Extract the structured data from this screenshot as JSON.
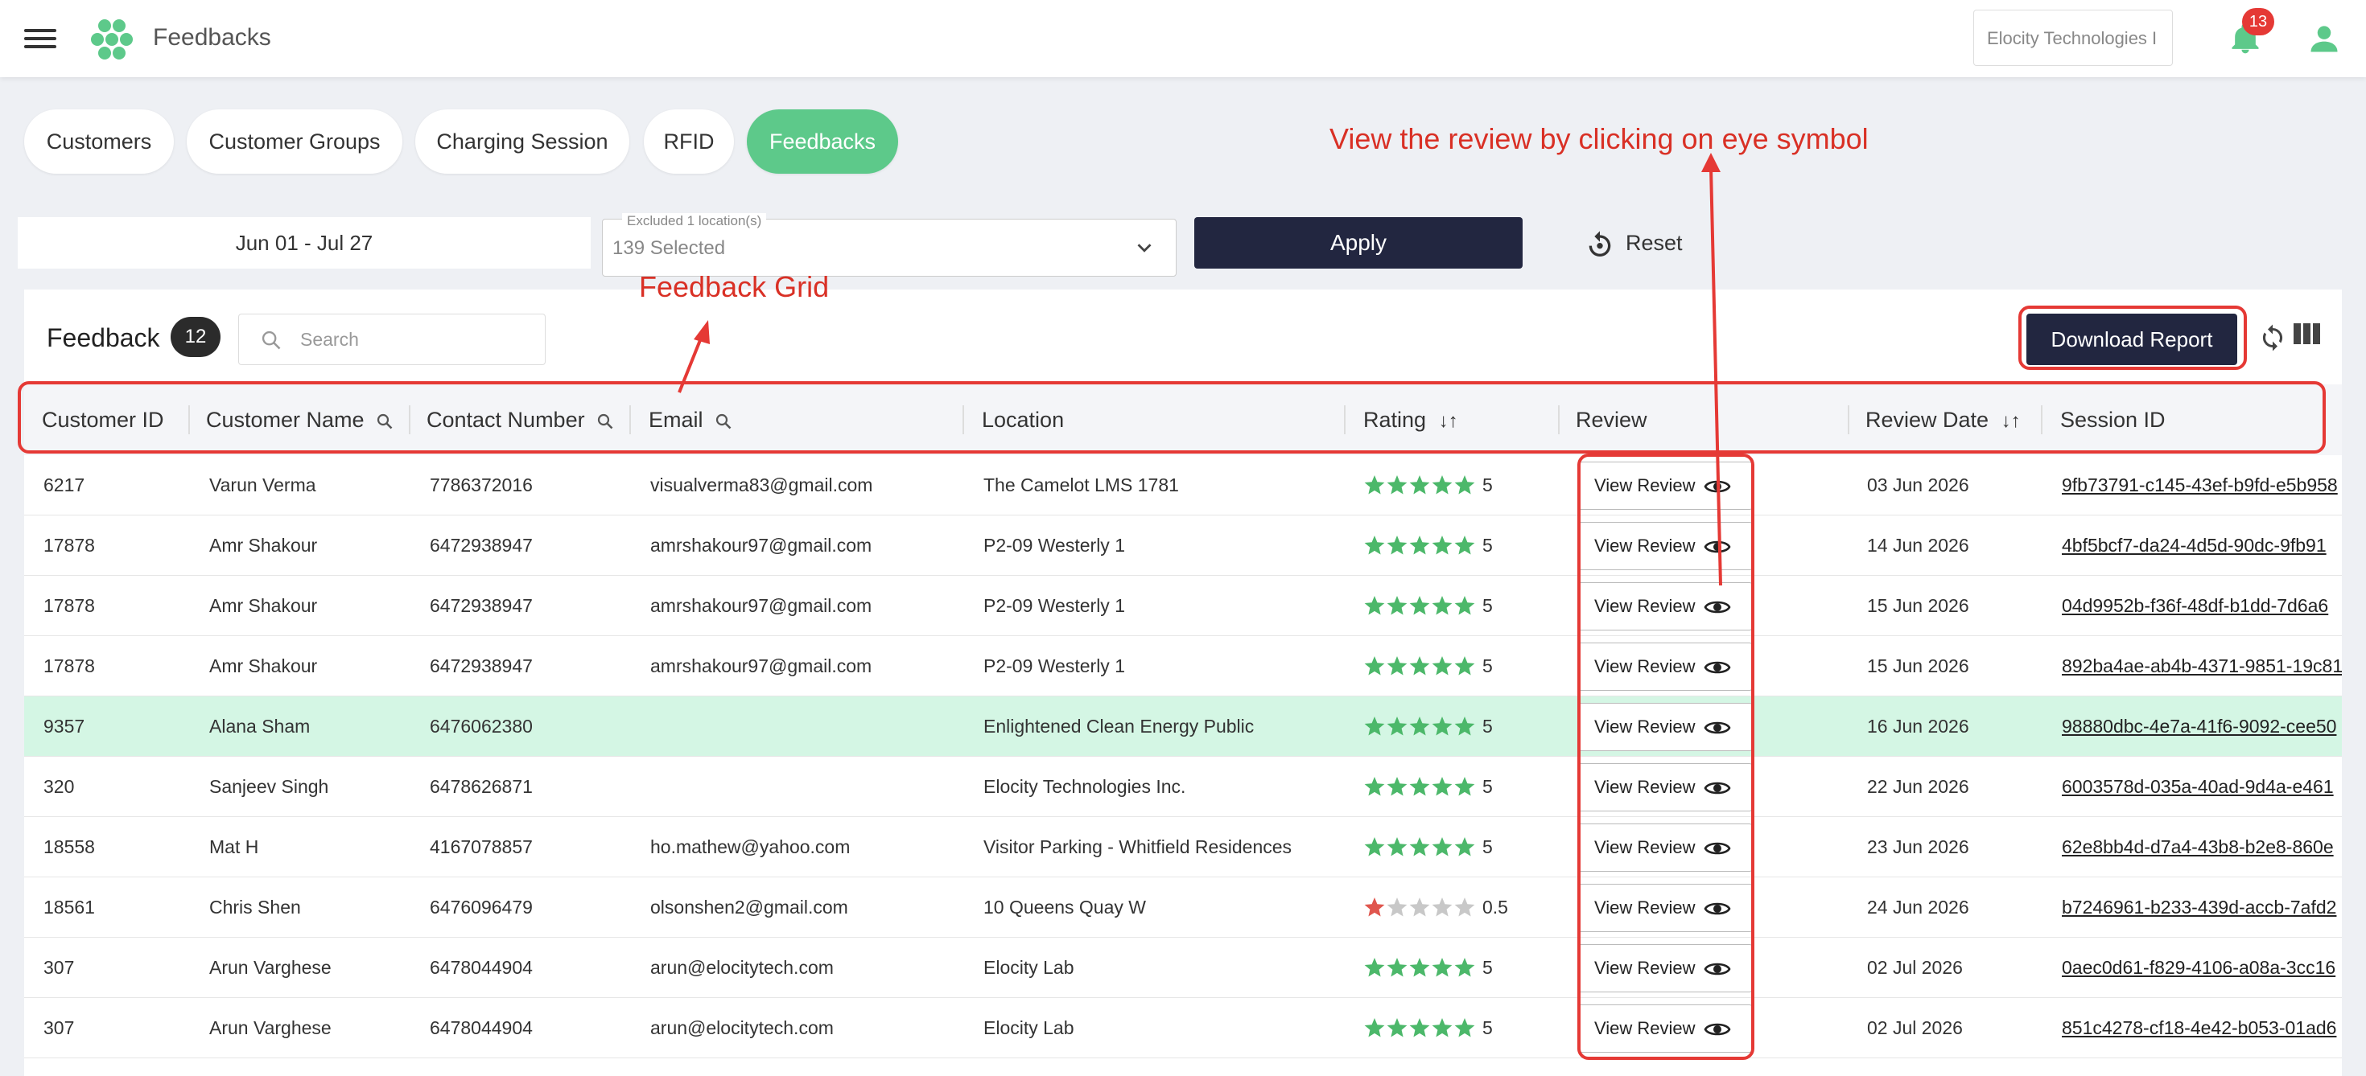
{
  "app": {
    "title": "Feedbacks"
  },
  "header": {
    "org_selector": "Elocity Technologies I",
    "notification_count": "13"
  },
  "tabs": [
    {
      "label": "Customers",
      "active": false
    },
    {
      "label": "Customer Groups",
      "active": false
    },
    {
      "label": "Charging Session",
      "active": false
    },
    {
      "label": "RFID",
      "active": false
    },
    {
      "label": "Feedbacks",
      "active": true
    }
  ],
  "filters": {
    "date_range": "Jun 01 - Jul 27",
    "location_label": "Excluded 1 location(s)",
    "location_value": "139 Selected",
    "apply_label": "Apply",
    "reset_label": "Reset"
  },
  "grid": {
    "title": "Feedback",
    "count": "12",
    "search_placeholder": "Search",
    "download_label": "Download Report",
    "columns": [
      "Customer ID",
      "Customer Name",
      "Contact Number",
      "Email",
      "Location",
      "Rating",
      "Review",
      "Review Date",
      "Session ID"
    ],
    "rows": [
      {
        "customer_id": "6217",
        "name": "Varun Verma",
        "contact": "7786372016",
        "email": "visualverma83@gmail.com",
        "location": "The Camelot LMS 1781",
        "rating": "5",
        "review": "View Review",
        "date": "03 Jun 2026",
        "session": "9fb73791-c145-43ef-b9fd-e5b958"
      },
      {
        "customer_id": "17878",
        "name": "Amr Shakour",
        "contact": "6472938947",
        "email": "amrshakour97@gmail.com",
        "location": "P2-09 Westerly 1",
        "rating": "5",
        "review": "View Review",
        "date": "14 Jun 2026",
        "session": "4bf5bcf7-da24-4d5d-90dc-9fb91"
      },
      {
        "customer_id": "17878",
        "name": "Amr Shakour",
        "contact": "6472938947",
        "email": "amrshakour97@gmail.com",
        "location": "P2-09 Westerly 1",
        "rating": "5",
        "review": "View Review",
        "date": "15 Jun 2026",
        "session": "04d9952b-f36f-48df-b1dd-7d6a6"
      },
      {
        "customer_id": "17878",
        "name": "Amr Shakour",
        "contact": "6472938947",
        "email": "amrshakour97@gmail.com",
        "location": "P2-09 Westerly 1",
        "rating": "5",
        "review": "View Review",
        "date": "15 Jun 2026",
        "session": "892ba4ae-ab4b-4371-9851-19c81"
      },
      {
        "customer_id": "9357",
        "name": "Alana Sham",
        "contact": "6476062380",
        "email": "",
        "location": "Enlightened Clean Energy Public",
        "rating": "5",
        "review": "View Review",
        "date": "16 Jun 2026",
        "session": "98880dbc-4e7a-41f6-9092-cee50"
      },
      {
        "customer_id": "320",
        "name": "Sanjeev Singh",
        "contact": "6478626871",
        "email": "",
        "location": "Elocity Technologies Inc.",
        "rating": "5",
        "review": "View Review",
        "date": "22 Jun 2026",
        "session": "6003578d-035a-40ad-9d4a-e461"
      },
      {
        "customer_id": "18558",
        "name": "Mat H",
        "contact": "4167078857",
        "email": "ho.mathew@yahoo.com",
        "location": "Visitor Parking - Whitfield Residences",
        "rating": "5",
        "review": "View Review",
        "date": "23 Jun 2026",
        "session": "62e8bb4d-d7a4-43b8-b2e8-860e"
      },
      {
        "customer_id": "18561",
        "name": "Chris Shen",
        "contact": "6476096479",
        "email": "olsonshen2@gmail.com",
        "location": "10 Queens Quay W",
        "rating": "0.5",
        "review": "View Review",
        "date": "24 Jun 2026",
        "session": "b7246961-b233-439d-accb-7afd2"
      },
      {
        "customer_id": "307",
        "name": "Arun Varghese",
        "contact": "6478044904",
        "email": "arun@elocitytech.com",
        "location": "Elocity Lab",
        "rating": "5",
        "review": "View Review",
        "date": "02 Jul 2026",
        "session": "0aec0d61-f829-4106-a08a-3cc16"
      },
      {
        "customer_id": "307",
        "name": "Arun Varghese",
        "contact": "6478044904",
        "email": "arun@elocitytech.com",
        "location": "Elocity Lab",
        "rating": "5",
        "review": "View Review",
        "date": "02 Jul 2026",
        "session": "851c4278-cf18-4e42-b053-01ad6"
      }
    ],
    "highlighted_row": 4
  },
  "annotations": {
    "eye_note": "View the review by clicking on eye symbol",
    "grid_note": "Feedback Grid"
  },
  "colors": {
    "accent": "#5dc98a",
    "primary_dark": "#222640",
    "annotation": "#e53935",
    "highlight_row": "#d4f6e4",
    "star_filled": "#4cb86a",
    "star_empty": "#c8c8c8"
  }
}
